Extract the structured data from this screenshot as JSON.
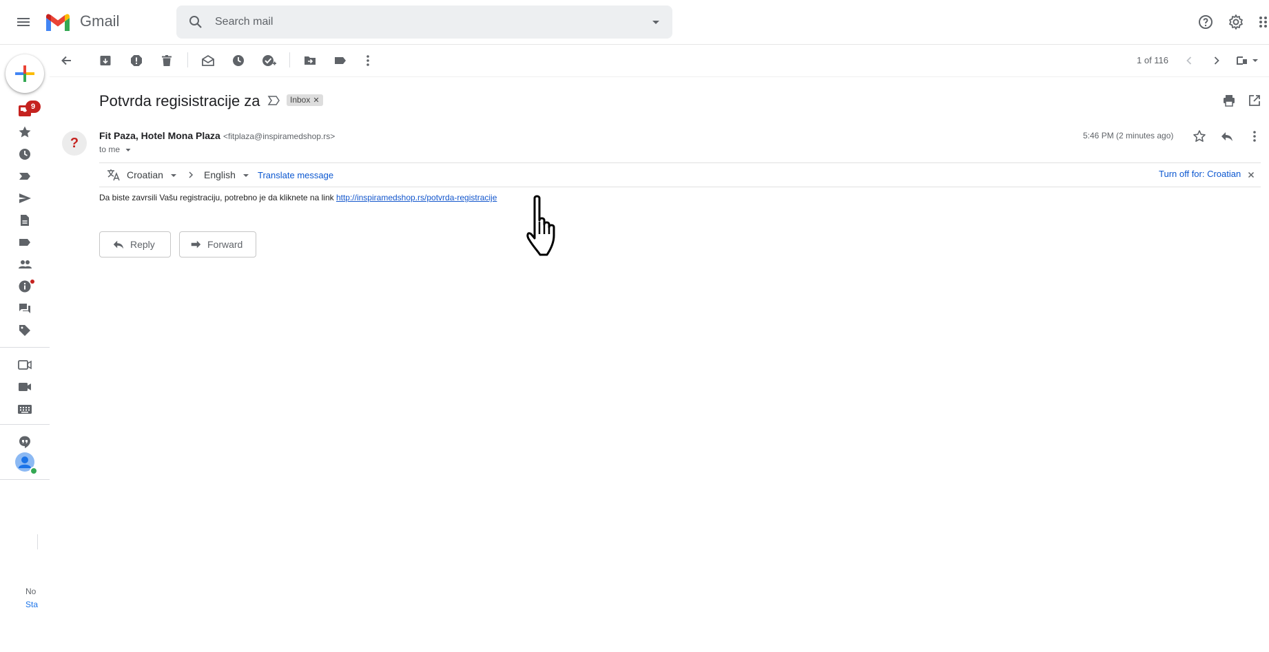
{
  "app": {
    "name": "Gmail"
  },
  "search": {
    "placeholder": "Search mail"
  },
  "rail": {
    "inbox_badge": "9"
  },
  "toolbar": {
    "count": "1 of 116"
  },
  "message": {
    "subject": "Potvrda regisistracije za",
    "label_chip": "Inbox",
    "avatar_letter": "?",
    "sender_name": "Fit Paza, Hotel Mona Plaza",
    "sender_email": "<fitplaza@inspiramedshop.rs>",
    "to": "to me",
    "time": "5:46 PM (2 minutes ago)",
    "body_text": "Da biste zavrsili Vašu registraciju, potrebno je da kliknete na link ",
    "body_link": "http://inspiramedshop.rs/potvrda-registracije"
  },
  "translate": {
    "from": "Croatian",
    "to": "English",
    "action": "Translate message",
    "turn_off": "Turn off for: Croatian"
  },
  "actions": {
    "reply": "Reply",
    "forward": "Forward"
  },
  "bottom": {
    "line1": "No",
    "line2": "Sta"
  },
  "colors": {
    "accent": "#1a73e8",
    "badge": "#c5221f",
    "link": "#1155cc"
  }
}
